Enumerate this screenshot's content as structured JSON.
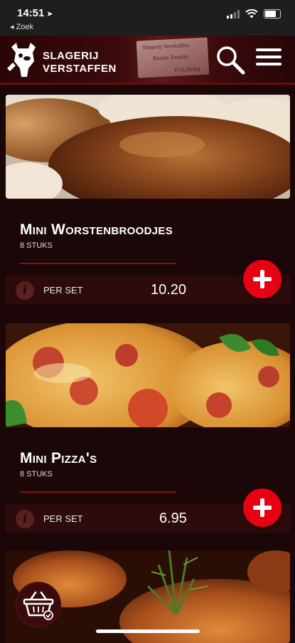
{
  "status_bar": {
    "time": "14:51",
    "back_label": "◂ Zoek"
  },
  "header": {
    "brand_line1": "SLAGERIJ",
    "brand_line2": "VERSTAFFEN",
    "label_card_line1": "Slagerij Verstaffen",
    "label_card_line2": "Runds Zwarte",
    "label_card_price": "€16,00/kg"
  },
  "products": [
    {
      "title": "Mini Worstenbroodjes",
      "subtitle": "8 STUKS",
      "unit": "PER SET",
      "price": "10.20"
    },
    {
      "title": "Mini Pizza's",
      "subtitle": "8 STUKS",
      "unit": "PER SET",
      "price": "6.95"
    }
  ],
  "icons": {
    "search": "search-icon",
    "menu": "hamburger-menu-icon",
    "info": "info-icon",
    "add": "plus-icon",
    "cart": "shopping-basket-icon"
  },
  "colors": {
    "accent_red": "#e60012",
    "background": "#1c0708",
    "bar": "#2d0a0b"
  }
}
